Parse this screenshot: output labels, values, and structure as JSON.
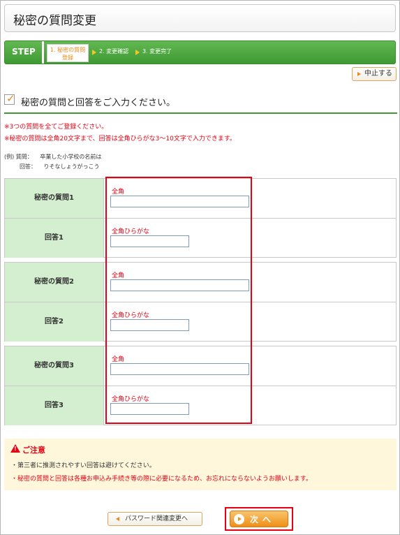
{
  "header": {
    "title": "秘密の質問変更"
  },
  "steps": {
    "label": "STEP",
    "items": [
      {
        "line1": "1. 秘密の質問",
        "line2": "登録",
        "current": true
      },
      {
        "text": "2. 変更確認"
      },
      {
        "text": "3. 変更完了"
      }
    ]
  },
  "cancel_button": {
    "label": "中止する"
  },
  "section": {
    "title": "秘密の質問と回答をご入力ください。"
  },
  "notes": [
    "※3つの質問を全てご登録ください。",
    "※秘密の質問は全角20文字まで、回答は全角ひらがな3～10文字で入力できます。"
  ],
  "example": {
    "q_label": "(例) 質問：",
    "q_value": "卒業した小学校の名前は",
    "a_label": "回答：",
    "a_value": "りそなしょうがっこう"
  },
  "form": {
    "groups": [
      {
        "question_label": "秘密の質問1",
        "question_hint": "全角",
        "question_value": "",
        "answer_label": "回答1",
        "answer_hint": "全角ひらがな",
        "answer_value": ""
      },
      {
        "question_label": "秘密の質問2",
        "question_hint": "全角",
        "question_value": "",
        "answer_label": "回答2",
        "answer_hint": "全角ひらがな",
        "answer_value": ""
      },
      {
        "question_label": "秘密の質問3",
        "question_hint": "全角",
        "question_value": "",
        "answer_label": "回答3",
        "answer_hint": "全角ひらがな",
        "answer_value": ""
      }
    ]
  },
  "caution": {
    "title": "ご注意",
    "lines": [
      "・第三者に推測されやすい回答は避けてください。",
      "・秘密の質問と回答は各種お申込み手続き等の際に必要になるため、お忘れにならないようお願いします。"
    ]
  },
  "buttons": {
    "back": "パスワード関連変更へ",
    "next": "次へ"
  },
  "colors": {
    "accent_green": "#3f9a33",
    "label_bg": "#d4efcf",
    "warning_red": "#e60012",
    "button_orange": "#ee8f16",
    "caution_bg": "#fff7dc"
  }
}
